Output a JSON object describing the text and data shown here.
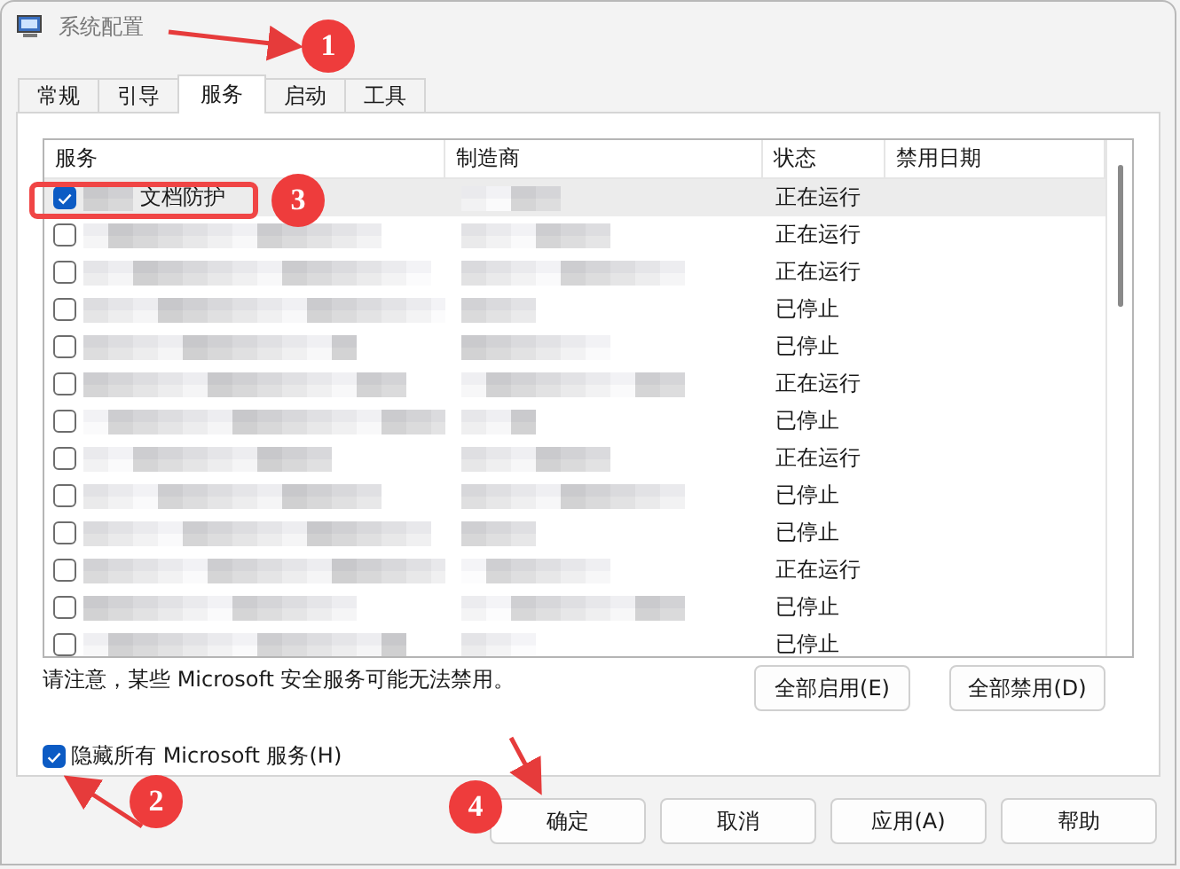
{
  "window": {
    "title": "系统配置"
  },
  "tabs": [
    {
      "label": "常规",
      "selected": false
    },
    {
      "label": "引导",
      "selected": false
    },
    {
      "label": "服务",
      "selected": true
    },
    {
      "label": "启动",
      "selected": false
    },
    {
      "label": "工具",
      "selected": false
    }
  ],
  "table": {
    "columns": [
      "服务",
      "制造商",
      "状态",
      "禁用日期"
    ],
    "rows": [
      {
        "name": "文档防护",
        "checked": true,
        "selected": true,
        "status": "正在运行"
      },
      {
        "checked": false,
        "selected": false,
        "status": "正在运行"
      },
      {
        "checked": false,
        "selected": false,
        "status": "正在运行"
      },
      {
        "checked": false,
        "selected": false,
        "status": "已停止"
      },
      {
        "checked": false,
        "selected": false,
        "status": "已停止"
      },
      {
        "checked": false,
        "selected": false,
        "status": "正在运行"
      },
      {
        "checked": false,
        "selected": false,
        "status": "已停止"
      },
      {
        "checked": false,
        "selected": false,
        "status": "正在运行"
      },
      {
        "checked": false,
        "selected": false,
        "status": "已停止"
      },
      {
        "checked": false,
        "selected": false,
        "status": "已停止"
      },
      {
        "checked": false,
        "selected": false,
        "status": "正在运行"
      },
      {
        "checked": false,
        "selected": false,
        "status": "已停止"
      },
      {
        "checked": false,
        "selected": false,
        "status": "已停止"
      }
    ]
  },
  "note": "请注意，某些 Microsoft 安全服务可能无法禁用。",
  "list_buttons": [
    "全部启用(E)",
    "全部禁用(D)"
  ],
  "hide_microsoft": {
    "label": "隐藏所有 Microsoft 服务(H)",
    "checked": true
  },
  "dialog_buttons": [
    "确定",
    "取消",
    "应用(A)",
    "帮助"
  ],
  "annotations": [
    {
      "label": "1"
    },
    {
      "label": "2"
    },
    {
      "label": "3"
    },
    {
      "label": "4"
    }
  ],
  "highlight_frame": true
}
